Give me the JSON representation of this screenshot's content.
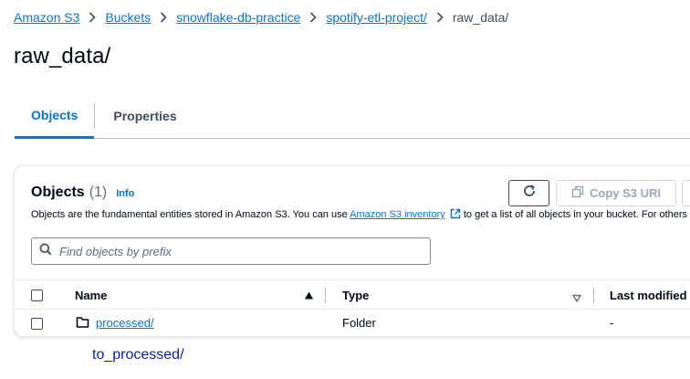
{
  "breadcrumb": {
    "items": [
      "Amazon S3",
      "Buckets",
      "snowflake-db-practice",
      "spotify-etl-project/"
    ],
    "current": "raw_data/"
  },
  "page": {
    "title": "raw_data/"
  },
  "tabs": [
    {
      "label": "Objects",
      "active": true
    },
    {
      "label": "Properties",
      "active": false
    }
  ],
  "objects_panel": {
    "title": "Objects",
    "count": "(1)",
    "info": "Info",
    "description_prefix": "Objects are the fundamental entities stored in Amazon S3. You can use ",
    "description_link": "Amazon S3 inventory",
    "description_suffix": " to get a list of all objects in your bucket. For others",
    "refresh_icon": "refresh-icon",
    "copy_button": "Copy S3 URI",
    "copy_icon": "copy-icon"
  },
  "search": {
    "placeholder": "Find objects by prefix",
    "value": ""
  },
  "table": {
    "columns": [
      "Name",
      "Type",
      "Last modified"
    ],
    "rows": [
      {
        "name": "processed/",
        "type": "Folder",
        "last_modified": "-"
      }
    ]
  },
  "caption": "to_processed/",
  "colors": {
    "link": "#0972d3",
    "text": "#000716",
    "muted": "#5f6b7a",
    "border": "#b6bec9",
    "caption": "#0a1fa8"
  }
}
